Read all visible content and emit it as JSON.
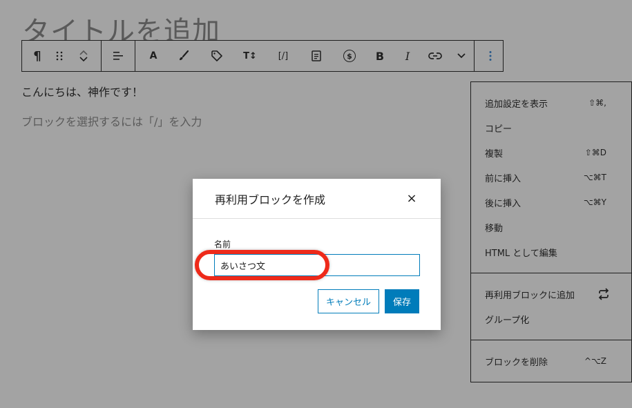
{
  "editor": {
    "title_placeholder": "タイトルを追加",
    "paragraph_text": "こんにちは、神作です！",
    "block_placeholder": "ブロックを選択するには「/」を入力"
  },
  "toolbar": {
    "paragraph_glyph": "¶",
    "text_color_glyph": "A",
    "format_glyph": "T↕",
    "code_glyph": "[/]",
    "currency_glyph": "$",
    "bold_glyph": "B",
    "italic_glyph": "I"
  },
  "menu": {
    "groups": [
      [
        {
          "label": "追加設定を表示",
          "shortcut": "⇧⌘,"
        },
        {
          "label": "コピー",
          "shortcut": ""
        },
        {
          "label": "複製",
          "shortcut": "⇧⌘D"
        },
        {
          "label": "前に挿入",
          "shortcut": "⌥⌘T"
        },
        {
          "label": "後に挿入",
          "shortcut": "⌥⌘Y"
        },
        {
          "label": "移動",
          "shortcut": ""
        },
        {
          "label": "HTML として編集",
          "shortcut": ""
        }
      ],
      [
        {
          "label": "再利用ブロックに追加",
          "shortcut": ""
        },
        {
          "label": "グループ化",
          "shortcut": ""
        }
      ],
      [
        {
          "label": "ブロックを削除",
          "shortcut": "^⌥Z"
        }
      ]
    ]
  },
  "modal": {
    "title": "再利用ブロックを作成",
    "close_glyph": "×",
    "name_label": "名前",
    "name_value": "あいさつ文",
    "cancel_label": "キャンセル",
    "save_label": "保存"
  },
  "colors": {
    "overlay": "#a3a3a3",
    "accent": "#007cba",
    "highlight": "#ee2a1a"
  }
}
